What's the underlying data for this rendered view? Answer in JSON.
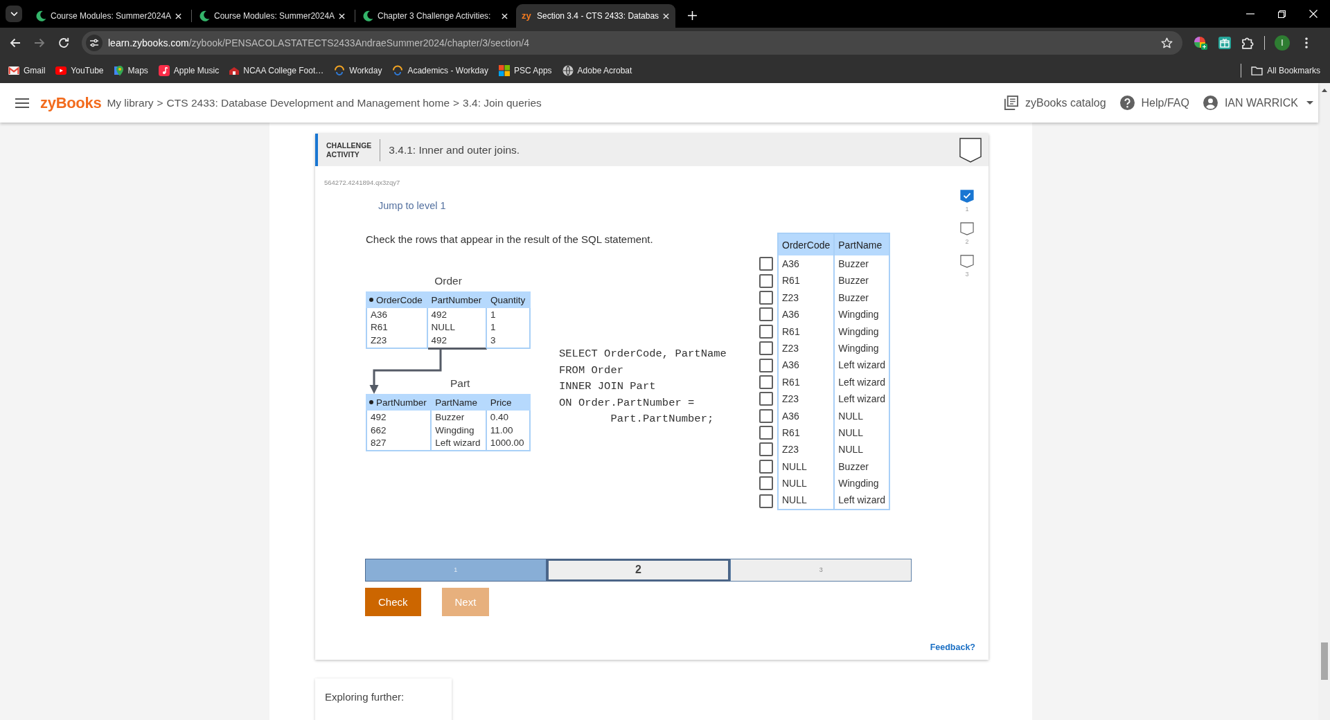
{
  "browser": {
    "tabs": [
      {
        "title": "Course Modules: Summer2024A",
        "kind": "swirl",
        "selected": false
      },
      {
        "title": "Course Modules: Summer2024A",
        "kind": "swirl",
        "selected": false
      },
      {
        "title": "Chapter 3 Challenge Activities:",
        "kind": "swirl",
        "selected": false
      },
      {
        "title": "Section 3.4 - CTS 2433: Databas",
        "kind": "text_logo",
        "logo": "zy",
        "selected": true
      }
    ],
    "can_go_forward": false,
    "address": {
      "host": "learn.zybooks.com",
      "path": "/zybook/PENSACOLASTATECTS2433AndraeSummer2024/chapter/3/section/4"
    },
    "profile_initial": "I",
    "bookmarks": [
      {
        "label": "Gmail",
        "kind": "mail"
      },
      {
        "label": "YouTube",
        "kind": "video"
      },
      {
        "label": "Maps",
        "kind": "maps"
      },
      {
        "label": "Apple Music",
        "kind": "music"
      },
      {
        "label": "NCAA College Foot…",
        "kind": "sports"
      },
      {
        "label": "Workday",
        "kind": "workday"
      },
      {
        "label": "Academics - Workday",
        "kind": "workday"
      },
      {
        "label": "PSC Apps",
        "kind": "apps"
      },
      {
        "label": "Adobe Acrobat",
        "kind": "globe"
      }
    ],
    "all_bookmarks": "All Bookmarks"
  },
  "header": {
    "logo": "zyBooks",
    "breadcrumb": [
      "My library",
      "CTS 2433: Database Development and Management home",
      "3.4: Join queries"
    ],
    "separator": ">",
    "nav": [
      {
        "label": "zyBooks catalog",
        "kind": "catalog"
      },
      {
        "label": "Help/FAQ",
        "kind": "help"
      },
      {
        "label": "IAN WARRICK",
        "kind": "account"
      }
    ]
  },
  "activity": {
    "type_label": "CHALLENGE ACTIVITY",
    "title": "3.4.1: Inner and outer joins.",
    "completed": false,
    "code": "564272.4241894.qx3zqy7",
    "jump_link": "Jump to level 1",
    "levels": [
      {
        "label": "1",
        "completed": true
      },
      {
        "label": "2",
        "completed": false
      },
      {
        "label": "3",
        "completed": false
      }
    ],
    "instruction": "Check the rows that appear in the result of the SQL statement.",
    "tables": [
      {
        "name": "Order",
        "columns": [
          {
            "label": "OrderCode",
            "primary_key": true,
            "foreign_key": false
          },
          {
            "label": "PartNumber",
            "primary_key": false,
            "foreign_key": true
          },
          {
            "label": "Quantity",
            "primary_key": false,
            "foreign_key": false
          }
        ],
        "rows": [
          [
            "A36",
            "492",
            "1"
          ],
          [
            "R61",
            "NULL",
            "1"
          ],
          [
            "Z23",
            "492",
            "3"
          ]
        ]
      },
      {
        "name": "Part",
        "columns": [
          {
            "label": "PartNumber",
            "primary_key": true,
            "foreign_key": false
          },
          {
            "label": "PartName",
            "primary_key": false,
            "foreign_key": false
          },
          {
            "label": "Price",
            "primary_key": false,
            "foreign_key": false
          }
        ],
        "rows": [
          [
            "492",
            "Buzzer",
            "0.40"
          ],
          [
            "662",
            "Wingding",
            "11.00"
          ],
          [
            "827",
            "Left wizard",
            "1000.00"
          ]
        ]
      }
    ],
    "sql": [
      "SELECT OrderCode, PartName",
      "FROM Order",
      "INNER JOIN Part",
      "ON Order.PartNumber =",
      "        Part.PartNumber;"
    ],
    "result": {
      "columns": [
        "OrderCode",
        "PartName"
      ],
      "rows": [
        {
          "cells": [
            "A36",
            "Buzzer"
          ],
          "checked": false
        },
        {
          "cells": [
            "R61",
            "Buzzer"
          ],
          "checked": false
        },
        {
          "cells": [
            "Z23",
            "Buzzer"
          ],
          "checked": false
        },
        {
          "cells": [
            "A36",
            "Wingding"
          ],
          "checked": false
        },
        {
          "cells": [
            "R61",
            "Wingding"
          ],
          "checked": false
        },
        {
          "cells": [
            "Z23",
            "Wingding"
          ],
          "checked": false
        },
        {
          "cells": [
            "A36",
            "Left wizard"
          ],
          "checked": false
        },
        {
          "cells": [
            "R61",
            "Left wizard"
          ],
          "checked": false
        },
        {
          "cells": [
            "Z23",
            "Left wizard"
          ],
          "checked": false
        },
        {
          "cells": [
            "A36",
            "NULL"
          ],
          "checked": false
        },
        {
          "cells": [
            "R61",
            "NULL"
          ],
          "checked": false
        },
        {
          "cells": [
            "Z23",
            "NULL"
          ],
          "checked": false
        },
        {
          "cells": [
            "NULL",
            "Buzzer"
          ],
          "checked": false
        },
        {
          "cells": [
            "NULL",
            "Wingding"
          ],
          "checked": false
        },
        {
          "cells": [
            "NULL",
            "Left wizard"
          ],
          "checked": false
        }
      ]
    },
    "progress": [
      {
        "label": "1",
        "completed": true,
        "selected": false
      },
      {
        "label": "2",
        "completed": false,
        "selected": true
      },
      {
        "label": "3",
        "completed": false,
        "selected": false
      }
    ],
    "buttons": [
      {
        "label": "Check",
        "disabled": false
      },
      {
        "label": "Next",
        "disabled": true
      }
    ],
    "feedback": "Feedback?"
  },
  "exploring": {
    "title": "Exploring further:"
  }
}
